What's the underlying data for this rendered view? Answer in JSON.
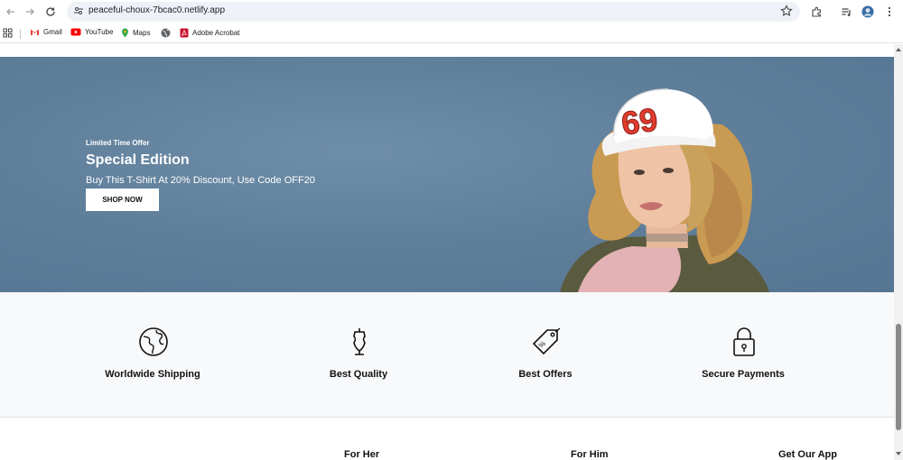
{
  "browser": {
    "url": "peaceful-choux-7bcac0.netlify.app",
    "bookmarks": [
      {
        "label": "Gmail",
        "icon": "gmail-icon"
      },
      {
        "label": "YouTube",
        "icon": "youtube-icon"
      },
      {
        "label": "Maps",
        "icon": "maps-icon"
      },
      {
        "label": "",
        "icon": "globe-icon"
      },
      {
        "label": "Adobe Acrobat",
        "icon": "acrobat-icon"
      }
    ]
  },
  "hero": {
    "kicker": "Limited Time Offer",
    "title": "Special Edition",
    "subtitle": "Buy This T-Shirt At 20% Discount, Use Code OFF20",
    "button": "SHOP NOW",
    "cap_text": "69"
  },
  "features": [
    {
      "label": "Worldwide Shipping",
      "icon": "globe-icon"
    },
    {
      "label": "Best Quality",
      "icon": "dress-form-icon"
    },
    {
      "label": "Best Offers",
      "icon": "price-tag-icon"
    },
    {
      "label": "Secure Payments",
      "icon": "padlock-icon"
    }
  ],
  "footer": {
    "headings": [
      "For Her",
      "For Him",
      "Get Our App"
    ]
  },
  "colors": {
    "hero_bg": "#5f7f9b",
    "cap_number": "#e23b2e",
    "feature_bg": "#f8f9fb"
  }
}
